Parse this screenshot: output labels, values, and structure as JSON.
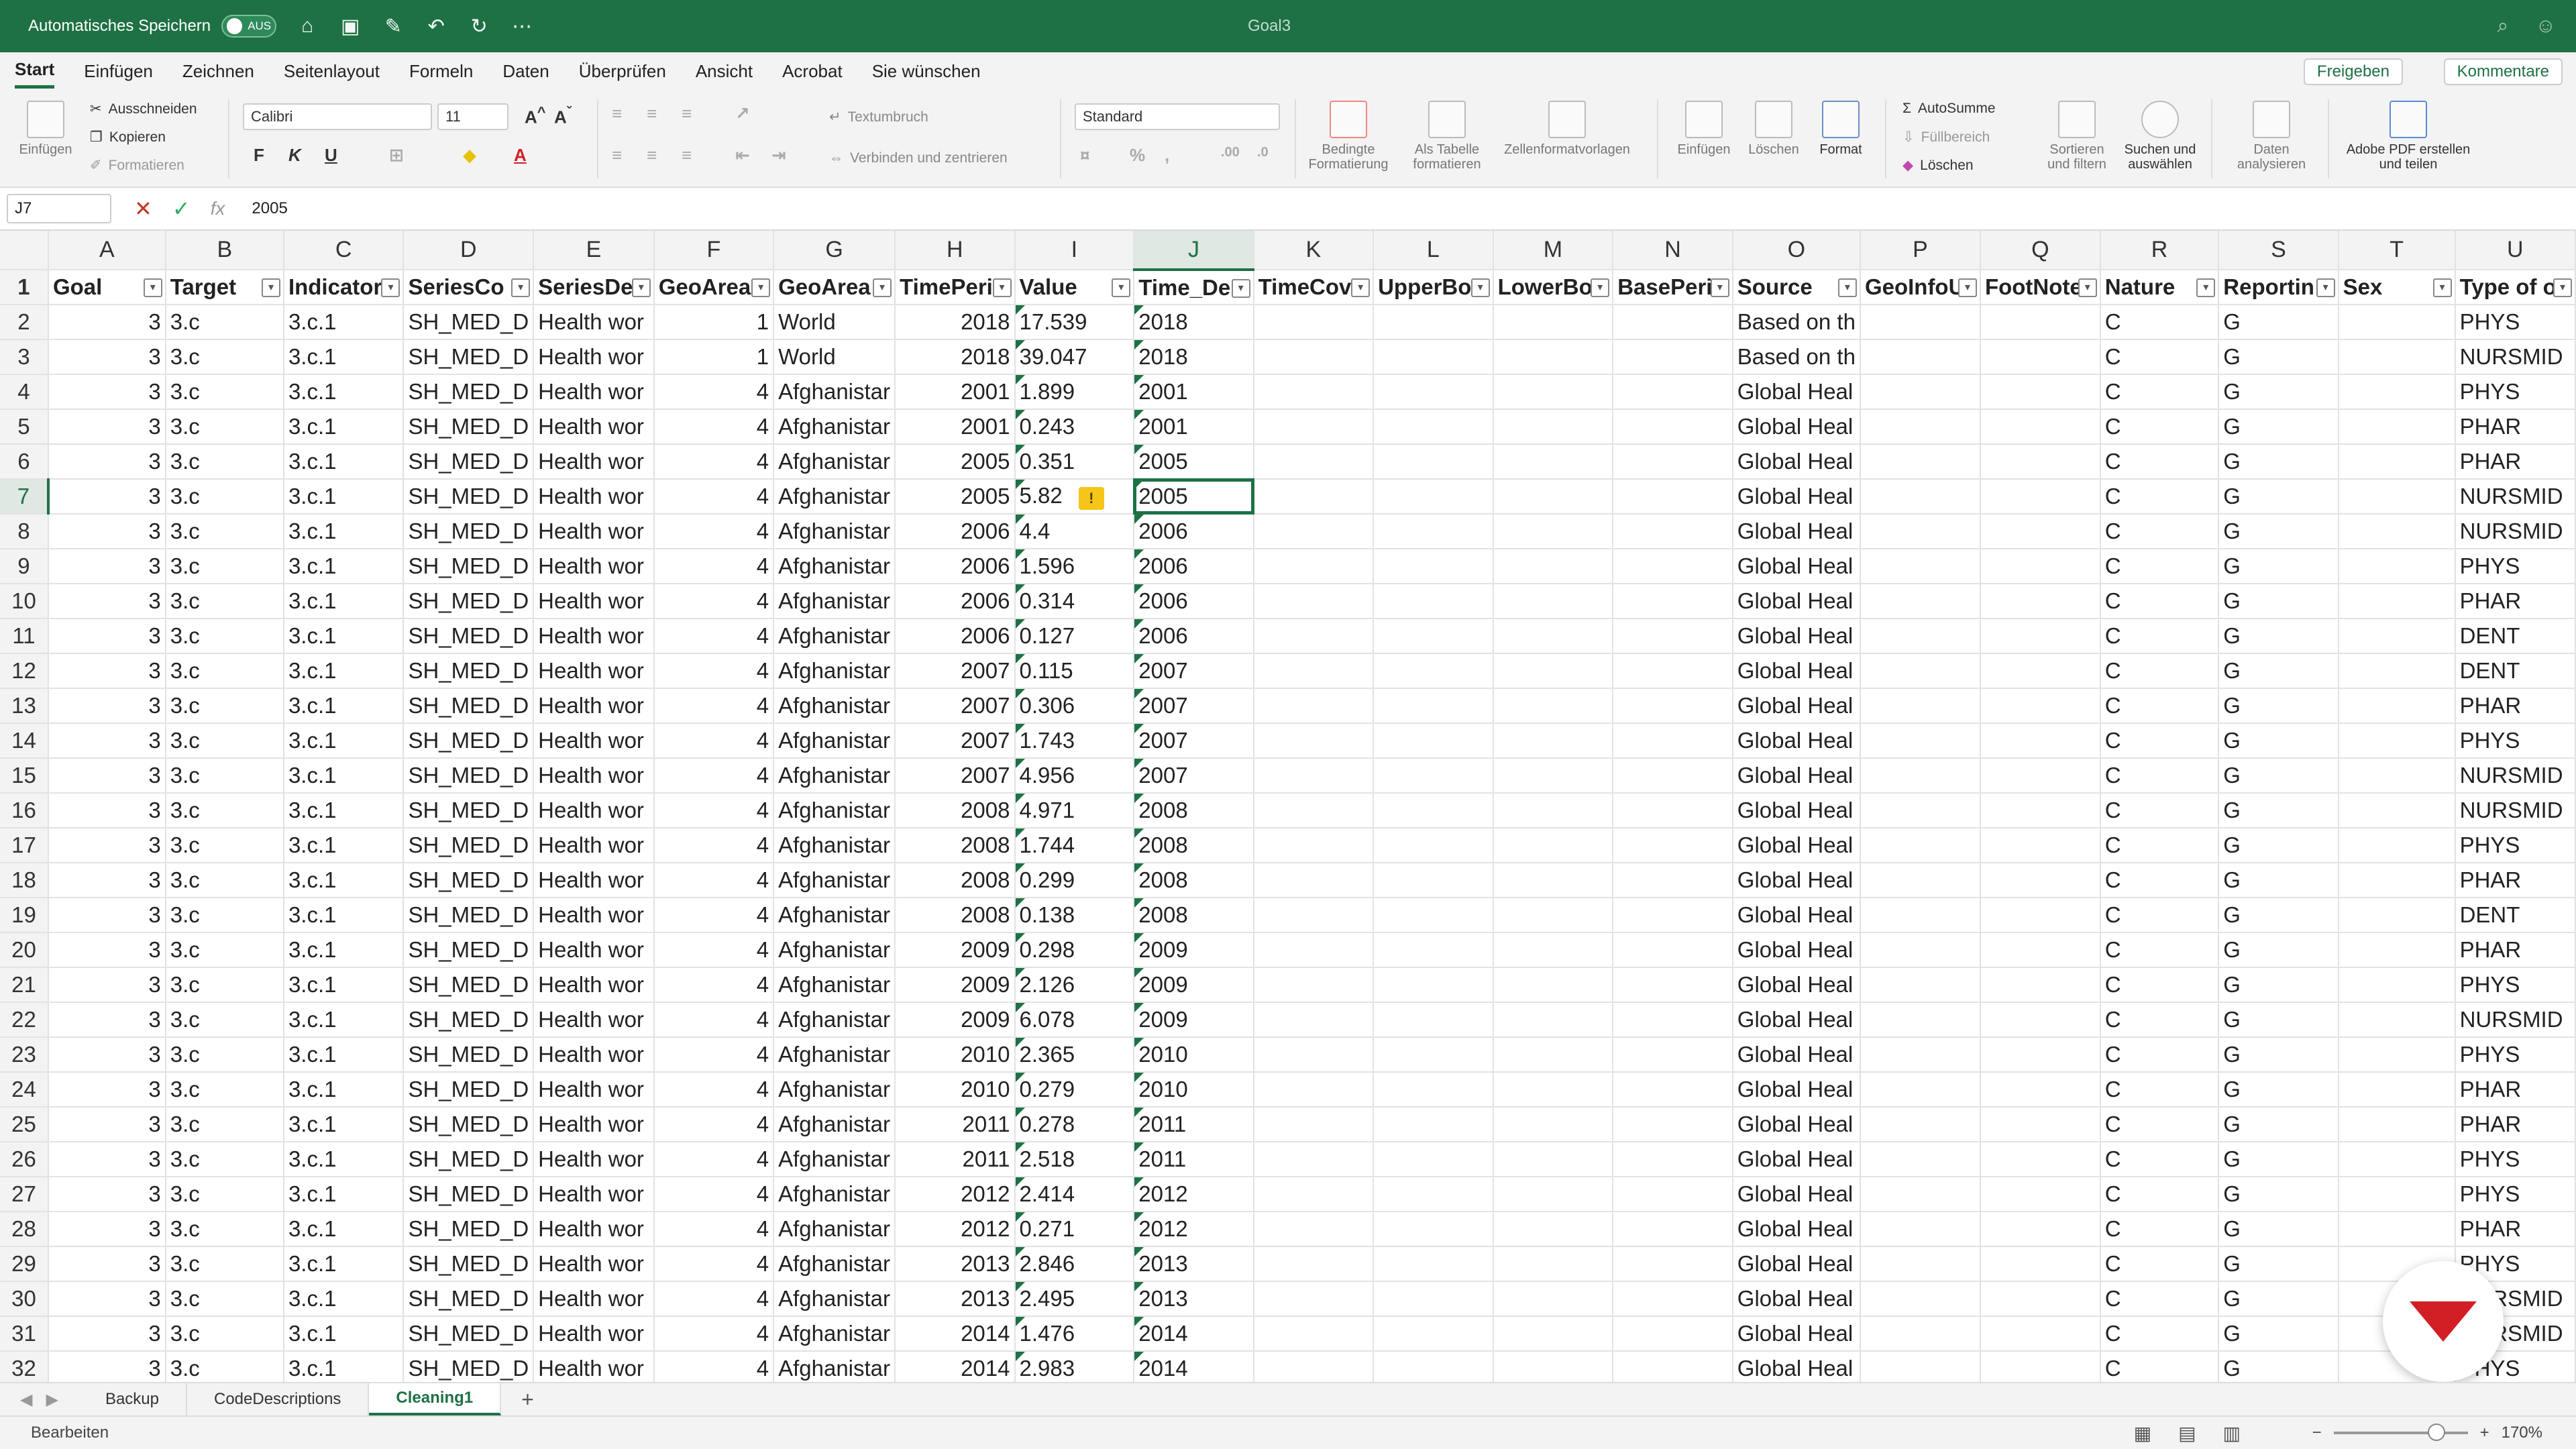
{
  "titlebar": {
    "autosave_label": "Automatisches Speichern",
    "autosave_state": "AUS",
    "doc_title": "Goal3"
  },
  "menu": {
    "tabs": [
      "Start",
      "Einfügen",
      "Zeichnen",
      "Seitenlayout",
      "Formeln",
      "Daten",
      "Überprüfen",
      "Ansicht",
      "Acrobat",
      "Sie wünschen"
    ],
    "share": "Freigeben",
    "comments": "Kommentare"
  },
  "ribbon": {
    "paste": "Einfügen",
    "cut": "Ausschneiden",
    "copy": "Kopieren",
    "format_painter": "Formatieren",
    "font_name": "Calibri",
    "font_size": "11",
    "bold": "F",
    "italic": "K",
    "underline": "U",
    "wrap_text": "Textumbruch",
    "merge_center": "Verbinden und zentrieren",
    "number_format": "Standard",
    "cond_format": "Bedingte Formatierung",
    "as_table": "Als Tabelle formatieren",
    "cell_styles": "Zellenformatvorlagen",
    "insert": "Einfügen",
    "delete": "Löschen",
    "format": "Format",
    "autosum": "AutoSumme",
    "fill": "Füllbereich",
    "clear": "Löschen",
    "sort_filter": "Sortieren und filtern",
    "find_select": "Suchen und auswählen",
    "analyze": "Daten analysieren",
    "adobe": "Adobe PDF erstellen und teilen"
  },
  "formulabar": {
    "cell_ref": "J7",
    "fx": "fx",
    "value": "2005"
  },
  "grid": {
    "columns": [
      "A",
      "B",
      "C",
      "D",
      "E",
      "F",
      "G",
      "H",
      "I",
      "J",
      "K",
      "L",
      "M",
      "N",
      "O",
      "P",
      "Q",
      "R",
      "S",
      "T",
      "U"
    ],
    "header_row": [
      "Goal",
      "Target",
      "Indicator",
      "SeriesCo",
      "SeriesDe",
      "GeoArea",
      "GeoArea",
      "TimePeri",
      "Value",
      "Time_De",
      "TimeCov",
      "UpperBo",
      "LowerBo",
      "BasePeri",
      "Source",
      "GeoInfoU",
      "FootNote",
      "Nature",
      "Reportin",
      "Sex",
      "Type of o"
    ],
    "rows": [
      [
        "3",
        "3.c",
        "3.c.1",
        "SH_MED_D",
        "Health wor",
        "1",
        "World",
        "2018",
        "17.539",
        "2018",
        "",
        "",
        "",
        "",
        "Based on th",
        "",
        "",
        "C",
        "G",
        "",
        "PHYS"
      ],
      [
        "3",
        "3.c",
        "3.c.1",
        "SH_MED_D",
        "Health wor",
        "1",
        "World",
        "2018",
        "39.047",
        "2018",
        "",
        "",
        "",
        "",
        "Based on th",
        "",
        "",
        "C",
        "G",
        "",
        "NURSMID"
      ],
      [
        "3",
        "3.c",
        "3.c.1",
        "SH_MED_D",
        "Health wor",
        "4",
        "Afghanistar",
        "2001",
        "1.899",
        "2001",
        "",
        "",
        "",
        "",
        "Global Heal",
        "",
        "",
        "C",
        "G",
        "",
        "PHYS"
      ],
      [
        "3",
        "3.c",
        "3.c.1",
        "SH_MED_D",
        "Health wor",
        "4",
        "Afghanistar",
        "2001",
        "0.243",
        "2001",
        "",
        "",
        "",
        "",
        "Global Heal",
        "",
        "",
        "C",
        "G",
        "",
        "PHAR"
      ],
      [
        "3",
        "3.c",
        "3.c.1",
        "SH_MED_D",
        "Health wor",
        "4",
        "Afghanistar",
        "2005",
        "0.351",
        "2005",
        "",
        "",
        "",
        "",
        "Global Heal",
        "",
        "",
        "C",
        "G",
        "",
        "PHAR"
      ],
      [
        "3",
        "3.c",
        "3.c.1",
        "SH_MED_D",
        "Health wor",
        "4",
        "Afghanistar",
        "2005",
        "5.82",
        "2005",
        "",
        "",
        "",
        "",
        "Global Heal",
        "",
        "",
        "C",
        "G",
        "",
        "NURSMID"
      ],
      [
        "3",
        "3.c",
        "3.c.1",
        "SH_MED_D",
        "Health wor",
        "4",
        "Afghanistar",
        "2006",
        "4.4",
        "2006",
        "",
        "",
        "",
        "",
        "Global Heal",
        "",
        "",
        "C",
        "G",
        "",
        "NURSMID"
      ],
      [
        "3",
        "3.c",
        "3.c.1",
        "SH_MED_D",
        "Health wor",
        "4",
        "Afghanistar",
        "2006",
        "1.596",
        "2006",
        "",
        "",
        "",
        "",
        "Global Heal",
        "",
        "",
        "C",
        "G",
        "",
        "PHYS"
      ],
      [
        "3",
        "3.c",
        "3.c.1",
        "SH_MED_D",
        "Health wor",
        "4",
        "Afghanistar",
        "2006",
        "0.314",
        "2006",
        "",
        "",
        "",
        "",
        "Global Heal",
        "",
        "",
        "C",
        "G",
        "",
        "PHAR"
      ],
      [
        "3",
        "3.c",
        "3.c.1",
        "SH_MED_D",
        "Health wor",
        "4",
        "Afghanistar",
        "2006",
        "0.127",
        "2006",
        "",
        "",
        "",
        "",
        "Global Heal",
        "",
        "",
        "C",
        "G",
        "",
        "DENT"
      ],
      [
        "3",
        "3.c",
        "3.c.1",
        "SH_MED_D",
        "Health wor",
        "4",
        "Afghanistar",
        "2007",
        "0.115",
        "2007",
        "",
        "",
        "",
        "",
        "Global Heal",
        "",
        "",
        "C",
        "G",
        "",
        "DENT"
      ],
      [
        "3",
        "3.c",
        "3.c.1",
        "SH_MED_D",
        "Health wor",
        "4",
        "Afghanistar",
        "2007",
        "0.306",
        "2007",
        "",
        "",
        "",
        "",
        "Global Heal",
        "",
        "",
        "C",
        "G",
        "",
        "PHAR"
      ],
      [
        "3",
        "3.c",
        "3.c.1",
        "SH_MED_D",
        "Health wor",
        "4",
        "Afghanistar",
        "2007",
        "1.743",
        "2007",
        "",
        "",
        "",
        "",
        "Global Heal",
        "",
        "",
        "C",
        "G",
        "",
        "PHYS"
      ],
      [
        "3",
        "3.c",
        "3.c.1",
        "SH_MED_D",
        "Health wor",
        "4",
        "Afghanistar",
        "2007",
        "4.956",
        "2007",
        "",
        "",
        "",
        "",
        "Global Heal",
        "",
        "",
        "C",
        "G",
        "",
        "NURSMID"
      ],
      [
        "3",
        "3.c",
        "3.c.1",
        "SH_MED_D",
        "Health wor",
        "4",
        "Afghanistar",
        "2008",
        "4.971",
        "2008",
        "",
        "",
        "",
        "",
        "Global Heal",
        "",
        "",
        "C",
        "G",
        "",
        "NURSMID"
      ],
      [
        "3",
        "3.c",
        "3.c.1",
        "SH_MED_D",
        "Health wor",
        "4",
        "Afghanistar",
        "2008",
        "1.744",
        "2008",
        "",
        "",
        "",
        "",
        "Global Heal",
        "",
        "",
        "C",
        "G",
        "",
        "PHYS"
      ],
      [
        "3",
        "3.c",
        "3.c.1",
        "SH_MED_D",
        "Health wor",
        "4",
        "Afghanistar",
        "2008",
        "0.299",
        "2008",
        "",
        "",
        "",
        "",
        "Global Heal",
        "",
        "",
        "C",
        "G",
        "",
        "PHAR"
      ],
      [
        "3",
        "3.c",
        "3.c.1",
        "SH_MED_D",
        "Health wor",
        "4",
        "Afghanistar",
        "2008",
        "0.138",
        "2008",
        "",
        "",
        "",
        "",
        "Global Heal",
        "",
        "",
        "C",
        "G",
        "",
        "DENT"
      ],
      [
        "3",
        "3.c",
        "3.c.1",
        "SH_MED_D",
        "Health wor",
        "4",
        "Afghanistar",
        "2009",
        "0.298",
        "2009",
        "",
        "",
        "",
        "",
        "Global Heal",
        "",
        "",
        "C",
        "G",
        "",
        "PHAR"
      ],
      [
        "3",
        "3.c",
        "3.c.1",
        "SH_MED_D",
        "Health wor",
        "4",
        "Afghanistar",
        "2009",
        "2.126",
        "2009",
        "",
        "",
        "",
        "",
        "Global Heal",
        "",
        "",
        "C",
        "G",
        "",
        "PHYS"
      ],
      [
        "3",
        "3.c",
        "3.c.1",
        "SH_MED_D",
        "Health wor",
        "4",
        "Afghanistar",
        "2009",
        "6.078",
        "2009",
        "",
        "",
        "",
        "",
        "Global Heal",
        "",
        "",
        "C",
        "G",
        "",
        "NURSMID"
      ],
      [
        "3",
        "3.c",
        "3.c.1",
        "SH_MED_D",
        "Health wor",
        "4",
        "Afghanistar",
        "2010",
        "2.365",
        "2010",
        "",
        "",
        "",
        "",
        "Global Heal",
        "",
        "",
        "C",
        "G",
        "",
        "PHYS"
      ],
      [
        "3",
        "3.c",
        "3.c.1",
        "SH_MED_D",
        "Health wor",
        "4",
        "Afghanistar",
        "2010",
        "0.279",
        "2010",
        "",
        "",
        "",
        "",
        "Global Heal",
        "",
        "",
        "C",
        "G",
        "",
        "PHAR"
      ],
      [
        "3",
        "3.c",
        "3.c.1",
        "SH_MED_D",
        "Health wor",
        "4",
        "Afghanistar",
        "2011",
        "0.278",
        "2011",
        "",
        "",
        "",
        "",
        "Global Heal",
        "",
        "",
        "C",
        "G",
        "",
        "PHAR"
      ],
      [
        "3",
        "3.c",
        "3.c.1",
        "SH_MED_D",
        "Health wor",
        "4",
        "Afghanistar",
        "2011",
        "2.518",
        "2011",
        "",
        "",
        "",
        "",
        "Global Heal",
        "",
        "",
        "C",
        "G",
        "",
        "PHYS"
      ],
      [
        "3",
        "3.c",
        "3.c.1",
        "SH_MED_D",
        "Health wor",
        "4",
        "Afghanistar",
        "2012",
        "2.414",
        "2012",
        "",
        "",
        "",
        "",
        "Global Heal",
        "",
        "",
        "C",
        "G",
        "",
        "PHYS"
      ],
      [
        "3",
        "3.c",
        "3.c.1",
        "SH_MED_D",
        "Health wor",
        "4",
        "Afghanistar",
        "2012",
        "0.271",
        "2012",
        "",
        "",
        "",
        "",
        "Global Heal",
        "",
        "",
        "C",
        "G",
        "",
        "PHAR"
      ],
      [
        "3",
        "3.c",
        "3.c.1",
        "SH_MED_D",
        "Health wor",
        "4",
        "Afghanistar",
        "2013",
        "2.846",
        "2013",
        "",
        "",
        "",
        "",
        "Global Heal",
        "",
        "",
        "C",
        "G",
        "",
        "PHYS"
      ],
      [
        "3",
        "3.c",
        "3.c.1",
        "SH_MED_D",
        "Health wor",
        "4",
        "Afghanistar",
        "2013",
        "2.495",
        "2013",
        "",
        "",
        "",
        "",
        "Global Heal",
        "",
        "",
        "C",
        "G",
        "",
        "NURSMID"
      ],
      [
        "3",
        "3.c",
        "3.c.1",
        "SH_MED_D",
        "Health wor",
        "4",
        "Afghanistar",
        "2014",
        "1.476",
        "2014",
        "",
        "",
        "",
        "",
        "Global Heal",
        "",
        "",
        "C",
        "G",
        "",
        "NURSMID"
      ],
      [
        "3",
        "3.c",
        "3.c.1",
        "SH_MED_D",
        "Health wor",
        "4",
        "Afghanistar",
        "2014",
        "2.983",
        "2014",
        "",
        "",
        "",
        "",
        "Global Heal",
        "",
        "",
        "C",
        "G",
        "",
        "PHYS"
      ]
    ]
  },
  "sheets": [
    "Backup",
    "CodeDescriptions",
    "Cleaning1"
  ],
  "active_sheet": "Cleaning1",
  "status": {
    "mode": "Bearbeiten",
    "zoom": "170%"
  }
}
